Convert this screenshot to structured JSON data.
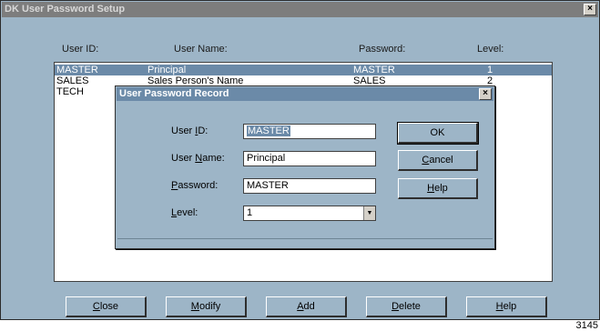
{
  "window": {
    "title": "DK User Password Setup",
    "close_glyph": "×"
  },
  "columns": [
    "User ID:",
    "User Name:",
    "Password:",
    "Level:"
  ],
  "rows": [
    {
      "id": "MASTER",
      "name": "Principal",
      "password": "MASTER",
      "level": "1"
    },
    {
      "id": "SALES",
      "name": "Sales Person's Name",
      "password": "SALES",
      "level": "2"
    },
    {
      "id": "TECH",
      "name": "",
      "password": "",
      "level": ""
    }
  ],
  "dialog": {
    "title": "User Password Record",
    "close_glyph": "×",
    "userid_label": {
      "pre": "User ",
      "u": "I",
      "post": "D:"
    },
    "username_label": {
      "pre": "User ",
      "u": "N",
      "post": "ame:"
    },
    "password_label": {
      "pre": "",
      "u": "P",
      "post": "assword:"
    },
    "level_label": {
      "pre": "",
      "u": "L",
      "post": "evel:"
    },
    "userid_value": "MASTER",
    "username_value": "Principal",
    "password_value": "MASTER",
    "level_value": "1",
    "ok": "OK",
    "cancel": {
      "pre": "",
      "u": "C",
      "post": "ancel"
    },
    "help": {
      "pre": "",
      "u": "H",
      "post": "elp"
    }
  },
  "buttons": {
    "close": {
      "pre": "",
      "u": "C",
      "post": "lose"
    },
    "modify": {
      "pre": "",
      "u": "M",
      "post": "odify"
    },
    "add": {
      "pre": "",
      "u": "A",
      "post": "dd"
    },
    "delete": {
      "pre": "",
      "u": "D",
      "post": "elete"
    },
    "help": {
      "pre": "",
      "u": "H",
      "post": "elp"
    }
  },
  "footnote": "3145",
  "colors": {
    "face": "#9db5c7",
    "selection": "#6b8aa8",
    "title_inactive": "#7d7d7d"
  }
}
